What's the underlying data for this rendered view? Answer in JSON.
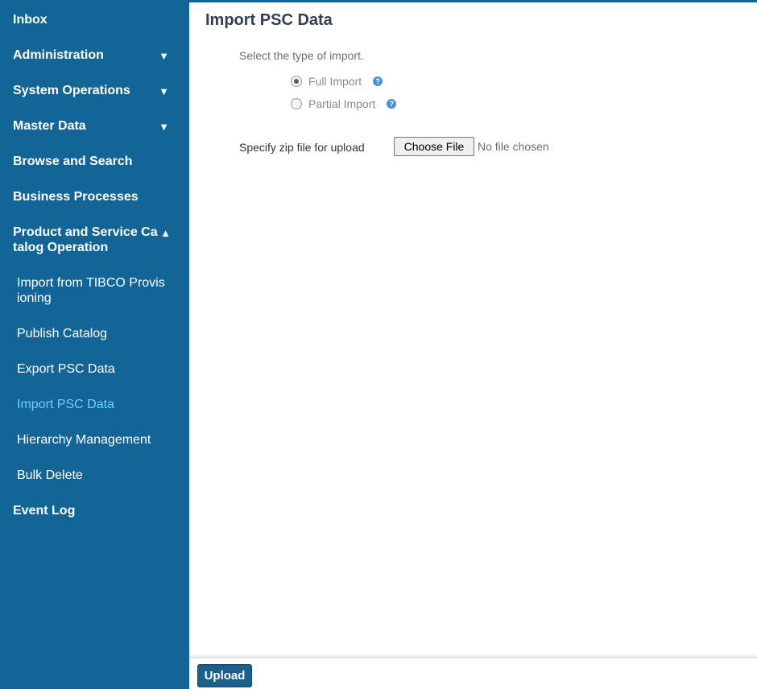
{
  "sidebar": {
    "items": [
      {
        "label": "Inbox"
      },
      {
        "label": "Administration",
        "caret": "▼"
      },
      {
        "label": "System Operations",
        "caret": "▼"
      },
      {
        "label": "Master Data",
        "caret": "▼"
      },
      {
        "label": "Browse and Search"
      },
      {
        "label": "Business Processes"
      },
      {
        "label": "Product and Service Catalog Operation",
        "label_line1": "Product and Service Ca",
        "label_line2": "talog Operation",
        "caret": "▲"
      },
      {
        "label": "Event Log"
      }
    ],
    "subitems": [
      {
        "label_line1": "Import from TIBCO Provis",
        "label_line2": "ioning"
      },
      {
        "label": "Publish Catalog"
      },
      {
        "label": "Export PSC Data"
      },
      {
        "label": "Import PSC Data"
      },
      {
        "label": "Hierarchy Management"
      },
      {
        "label": "Bulk Delete"
      }
    ]
  },
  "main": {
    "title": "Import PSC Data",
    "prompt": "Select the type of import.",
    "options": [
      {
        "label": "Full Import",
        "selected": true,
        "help_icon": "?"
      },
      {
        "label": "Partial Import",
        "selected": false,
        "help_icon": "?"
      }
    ],
    "file_label": "Specify zip file for upload",
    "file_button": "Choose File",
    "file_status": "No file chosen"
  },
  "footer": {
    "upload_label": "Upload"
  },
  "colors": {
    "sidebar_bg": "#136598",
    "active_link": "#6fd0ff",
    "title_text": "#333f4f",
    "upload_button": "#1b5f8c"
  }
}
